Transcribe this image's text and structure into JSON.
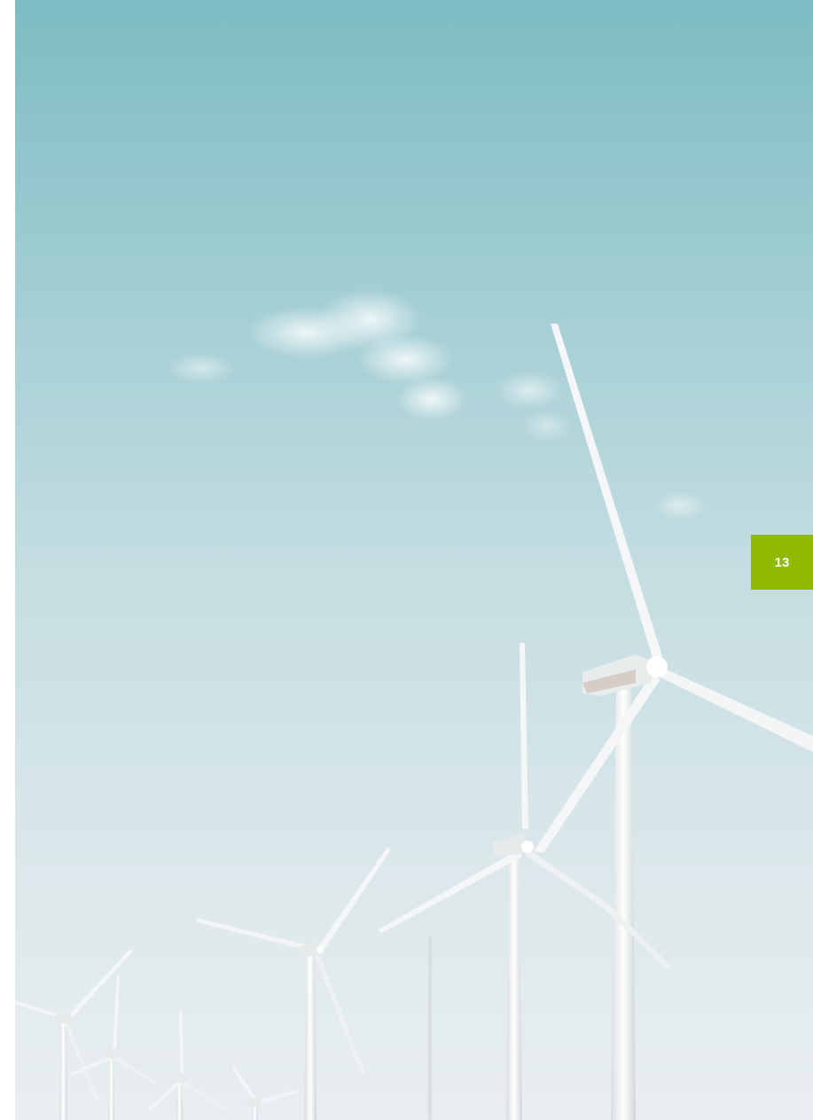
{
  "page": {
    "number": "13",
    "accent_color": "#8fba00"
  },
  "photo": {
    "subject": "wind-turbines",
    "sky_top_color": "#7cbcc2",
    "sky_bottom_color": "#e9eef0"
  }
}
